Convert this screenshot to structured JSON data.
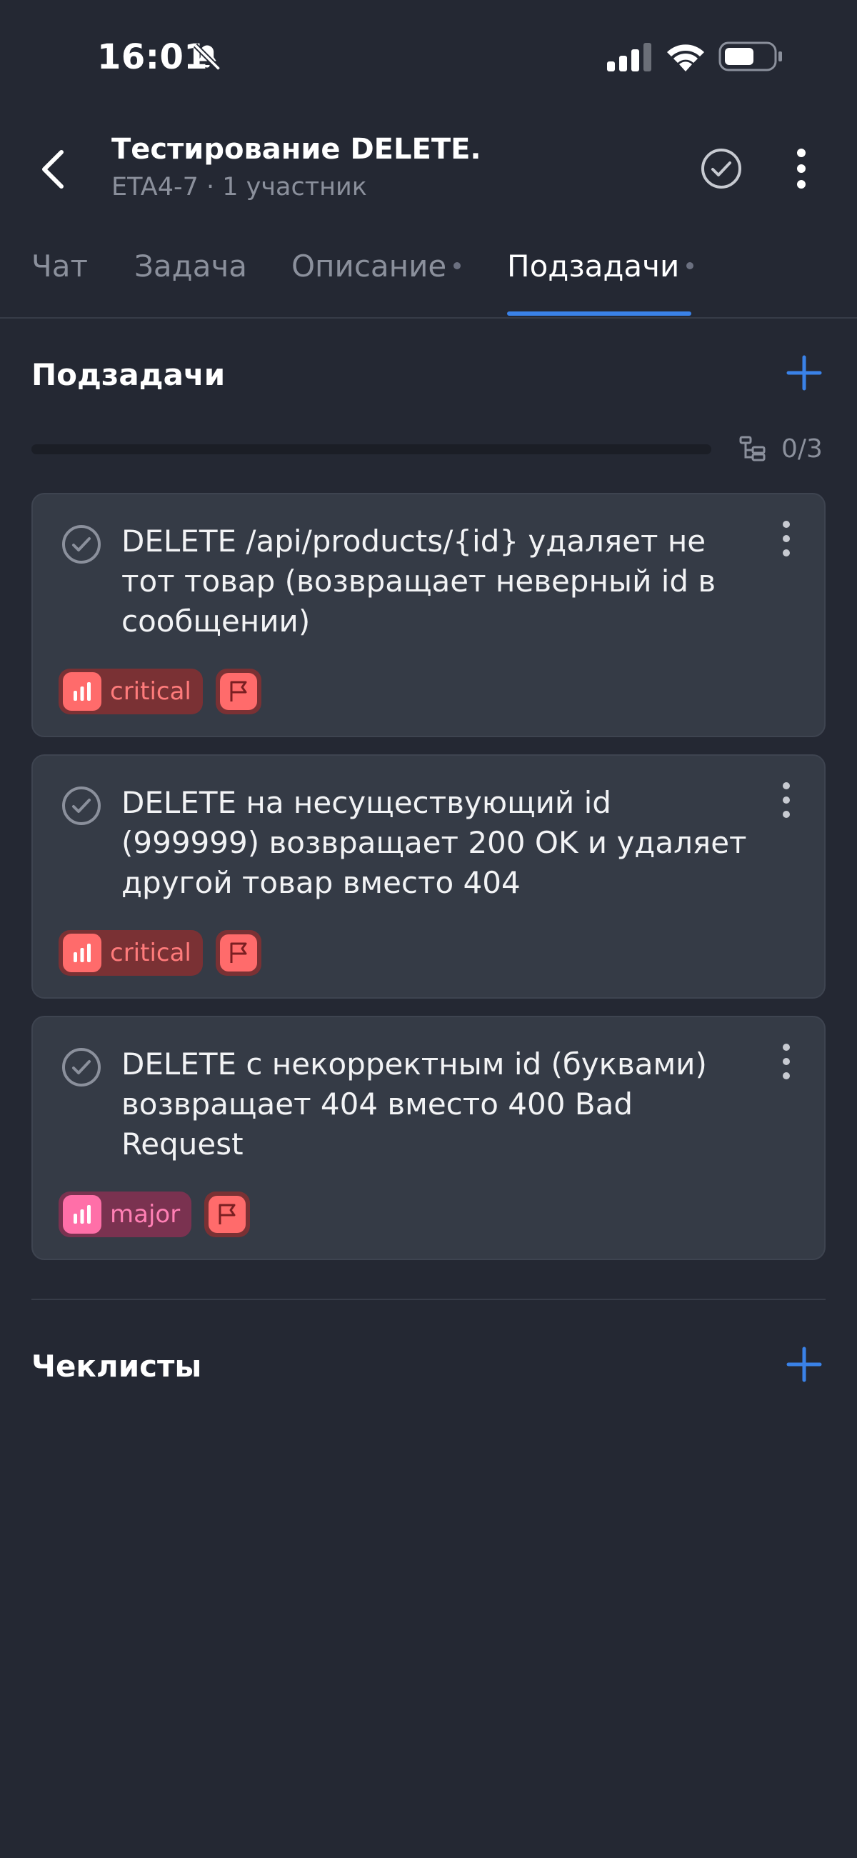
{
  "status": {
    "time": "16:01"
  },
  "header": {
    "title": "Тестирование DELETE.",
    "subtitle": "ETA4-7 · 1 участник"
  },
  "tabs": [
    {
      "label": "Чат",
      "active": false,
      "dot": false
    },
    {
      "label": "Задача",
      "active": false,
      "dot": false
    },
    {
      "label": "Описание",
      "active": false,
      "dot": true
    },
    {
      "label": "Подзадачи",
      "active": true,
      "dot": true
    }
  ],
  "subtasks": {
    "title": "Подзадачи",
    "progress_count": "0/3",
    "progress_fraction": 0,
    "items": [
      {
        "text": "DELETE /api/products/{id} удаляет не тот товар (возвращает неверный id в сообщении)",
        "priority": "critical"
      },
      {
        "text": "DELETE на несуществующий id (999999) возвращает 200 OK и удаляет другой товар вместо 404",
        "priority": "critical"
      },
      {
        "text": "DELETE с некорректным id (буквами) возвращает 404 вместо 400 Bad Request",
        "priority": "major"
      }
    ]
  },
  "checklists": {
    "title": "Чеклисты"
  },
  "colors": {
    "background": "#242833",
    "card": "#353b46",
    "accent": "#3a82e8",
    "critical": "#ff6b6b",
    "major": "#ff6fa8",
    "muted": "#8b909c"
  },
  "icons": {
    "back": "chevron-left-icon",
    "complete": "check-circle-icon",
    "more": "more-vertical-icon",
    "add": "plus-icon",
    "priority": "bar-chart-icon",
    "flag": "flag-icon",
    "subtask": "subtask-tree-icon"
  }
}
